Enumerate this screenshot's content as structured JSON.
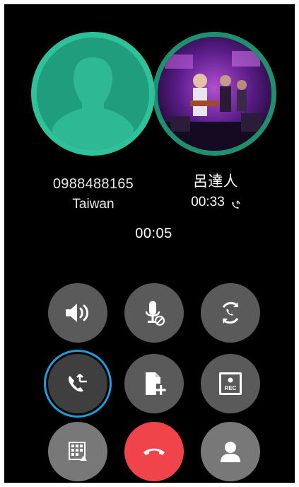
{
  "call": {
    "caller1": {
      "number": "0988488165",
      "location": "Taiwan"
    },
    "caller2": {
      "name": "呂達人",
      "duration": "00:33",
      "status_icon": "wifi-call-icon"
    },
    "active_timer": "00:05"
  },
  "controls": {
    "row1": [
      "speaker-icon",
      "mic-muted-icon",
      "swap-call-icon"
    ],
    "row2": [
      "merge-call-icon",
      "add-note-icon",
      "record-icon"
    ],
    "row3": [
      "dialpad-icon",
      "end-call-icon",
      "contacts-icon"
    ],
    "record_label": "REC"
  },
  "colors": {
    "avatar_ring": "#2fc29a",
    "end_call": "#f0444a",
    "active_ring": "#1aa0e0"
  }
}
